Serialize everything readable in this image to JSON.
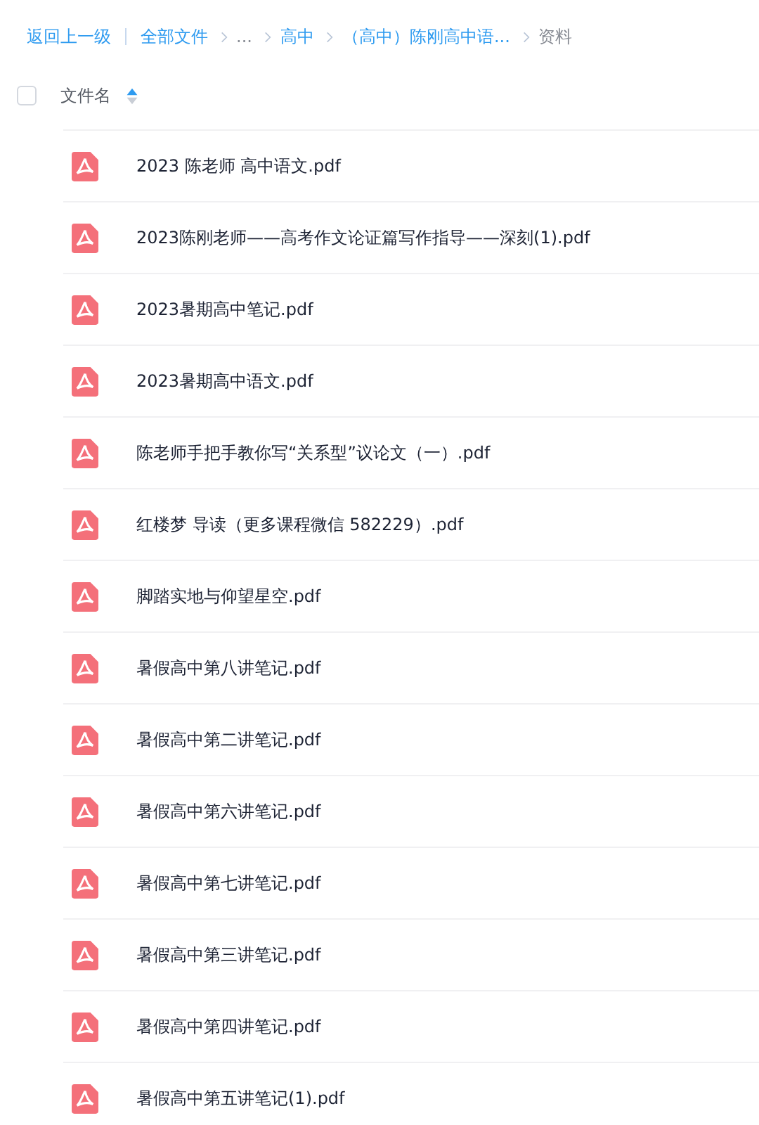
{
  "breadcrumb": {
    "back": "返回上一级",
    "items": [
      {
        "label": "全部文件",
        "kind": "link"
      },
      {
        "label": "...",
        "kind": "ellipsis"
      },
      {
        "label": "高中",
        "kind": "link"
      },
      {
        "label": "（高中）陈刚高中语...",
        "kind": "link"
      },
      {
        "label": "资料",
        "kind": "current"
      }
    ]
  },
  "table": {
    "select_all": {
      "checked": false
    },
    "columns": [
      {
        "label": "文件名",
        "sort_ascending": true
      }
    ],
    "rows": [
      {
        "name": "2023 陈老师 高中语文.pdf"
      },
      {
        "name": "2023陈刚老师——高考作文论证篇写作指导——深刻(1).pdf"
      },
      {
        "name": "2023暑期高中笔记.pdf"
      },
      {
        "name": "2023暑期高中语文.pdf"
      },
      {
        "name": "陈老师手把手教你写“关系型”议论文（一）.pdf"
      },
      {
        "name": "红楼梦 导读（更多课程微信 582229）.pdf"
      },
      {
        "name": "脚踏实地与仰望星空.pdf"
      },
      {
        "name": "暑假高中第八讲笔记.pdf"
      },
      {
        "name": "暑假高中第二讲笔记.pdf"
      },
      {
        "name": "暑假高中第六讲笔记.pdf"
      },
      {
        "name": "暑假高中第七讲笔记.pdf"
      },
      {
        "name": "暑假高中第三讲笔记.pdf"
      },
      {
        "name": "暑假高中第四讲笔记.pdf"
      },
      {
        "name": "暑假高中第五讲笔记(1).pdf"
      }
    ]
  }
}
